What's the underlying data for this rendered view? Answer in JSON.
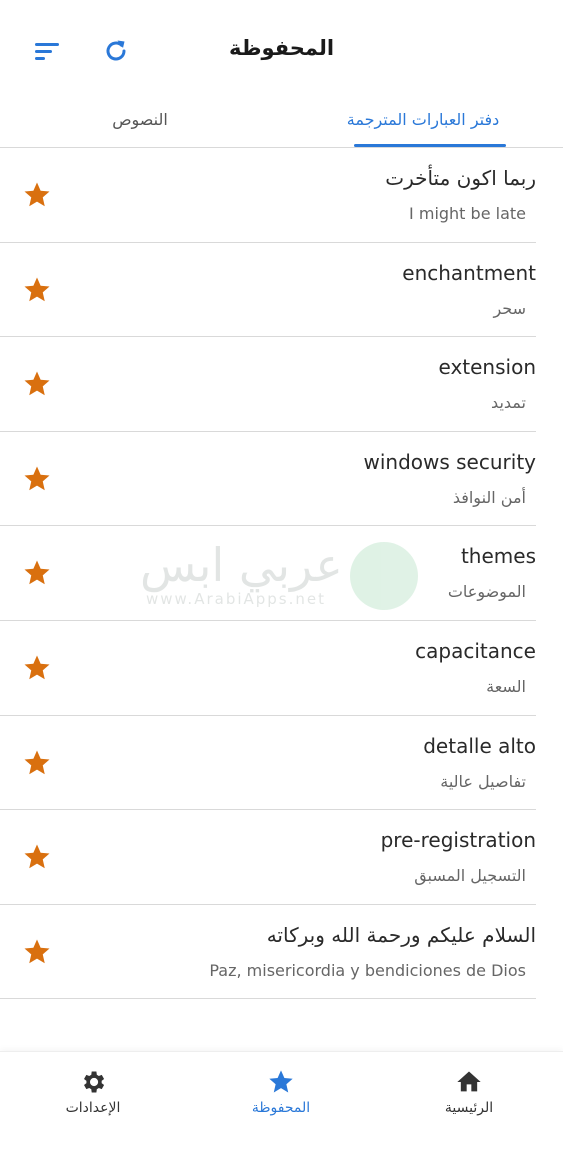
{
  "header": {
    "title": "المحفوظة",
    "sort_icon": "sort-lines-icon",
    "refresh_icon": "refresh-icon",
    "accent_color": "#2a78d8"
  },
  "tabs": [
    {
      "label": "دفتر العبارات المترجمة",
      "active": true
    },
    {
      "label": "النصوص",
      "active": false
    }
  ],
  "items": [
    {
      "title": "ربما اكون متأخرت",
      "subtitle": "I might be late"
    },
    {
      "title": "enchantment",
      "subtitle": "سحر"
    },
    {
      "title": "extension",
      "subtitle": "تمديد"
    },
    {
      "title": "windows security",
      "subtitle": "أمن النوافذ"
    },
    {
      "title": "themes",
      "subtitle": "الموضوعات"
    },
    {
      "title": "capacitance",
      "subtitle": "السعة"
    },
    {
      "title": "detalle alto",
      "subtitle": "تفاصيل عالية"
    },
    {
      "title": "pre-registration",
      "subtitle": "التسجيل المسبق"
    },
    {
      "title": "السلام عليكم ورحمة الله وبركاته",
      "subtitle": "Paz, misericordia y bendiciones de Dios"
    }
  ],
  "star_color": "#d9700f",
  "watermark": {
    "text": "عربي ابس",
    "url": "www.ArabiApps.net"
  },
  "bottom_nav": {
    "settings": {
      "label": "الإعدادات",
      "icon": "gear-icon"
    },
    "saved": {
      "label": "المحفوظة",
      "icon": "star-icon",
      "active": true
    },
    "home": {
      "label": "الرئيسية",
      "icon": "home-icon"
    }
  }
}
